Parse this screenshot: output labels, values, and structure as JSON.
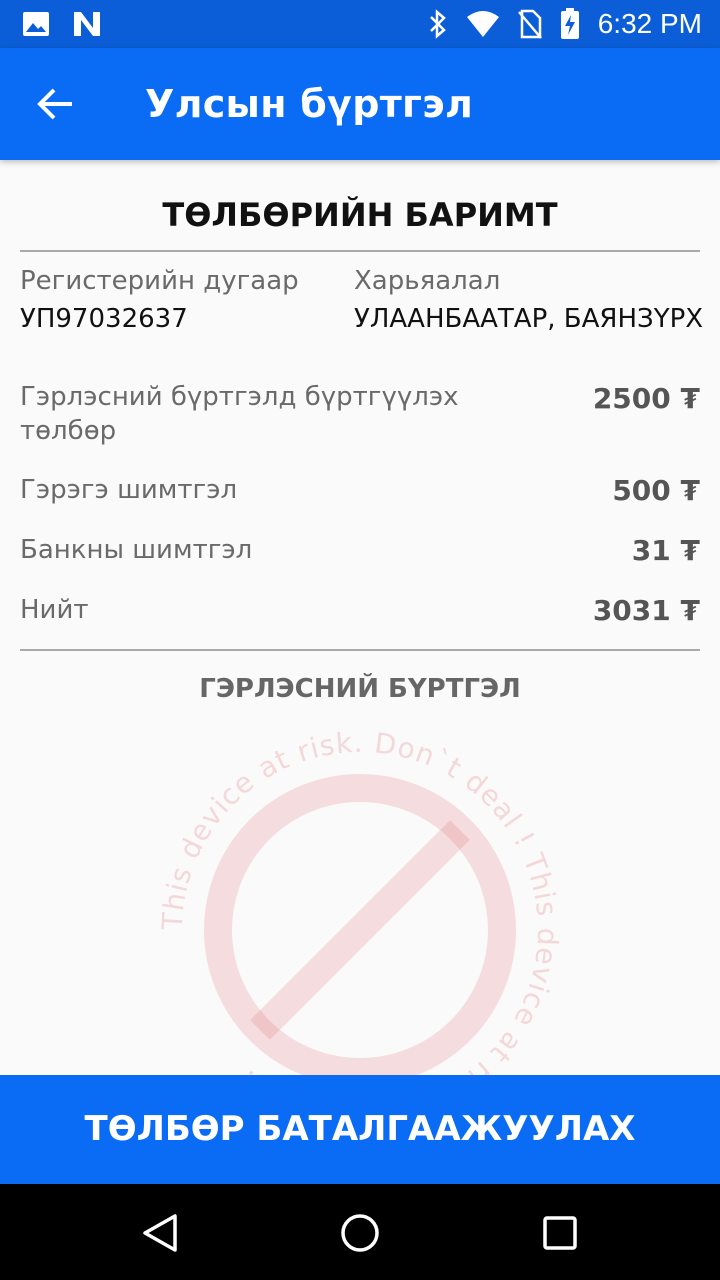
{
  "status_bar": {
    "time": "6:32 PM",
    "icons": [
      "image-icon",
      "n-app-icon",
      "bluetooth-icon",
      "wifi-icon",
      "no-sim-icon",
      "battery-charging-icon"
    ]
  },
  "app_bar": {
    "back_icon": "arrow-left-icon",
    "title": "Улсын бүртгэл"
  },
  "receipt": {
    "title": "ТӨЛБӨРИЙН БАРИМТ",
    "register_label": "Регистерийн дугаар",
    "register_value": "УП97032637",
    "jurisdiction_label": "Харьяалал",
    "jurisdiction_value": "УЛААНБААТАР, БАЯНЗҮРХ",
    "fees": [
      {
        "label": "Гэрлэсний бүртгэлд бүртгүүлэх төлбөр",
        "amount": "2500 ₮"
      },
      {
        "label": "Гэрэгэ шимтгэл",
        "amount": "500 ₮"
      },
      {
        "label": "Банкны шимтгэл",
        "amount": "31 ₮"
      },
      {
        "label": "Нийт",
        "amount": "3031 ₮"
      }
    ],
    "section_title": "ГЭРЛЭСНИЙ БҮРТГЭЛ"
  },
  "watermark": {
    "text": "This device at risk. Don`t deal !",
    "color": "#e05a66"
  },
  "confirm_button": {
    "label": "ТӨЛБӨР БАТАЛГААЖУУЛАХ"
  },
  "nav_bar": {
    "icons": [
      "back-triangle-icon",
      "home-circle-icon",
      "recents-square-icon"
    ]
  },
  "colors": {
    "primary": "#0a6cf5",
    "status_bar": "#0b5ed7"
  }
}
